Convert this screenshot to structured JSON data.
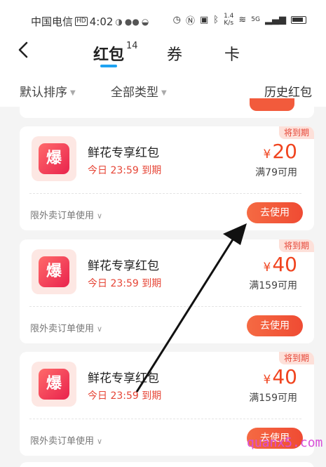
{
  "status_bar": {
    "carrier": "中国电信",
    "hd": "HD",
    "time": "4:02",
    "net_speed_value": "1.4",
    "net_speed_unit": "K/s",
    "network": "5G"
  },
  "header": {
    "tabs": [
      {
        "label": "红包",
        "count": "14"
      },
      {
        "label": "券"
      },
      {
        "label": "卡"
      }
    ],
    "active_tab_color": "#1ea3f2"
  },
  "filters": {
    "sort": "默认排序",
    "type": "全部类型",
    "history": "历史红包"
  },
  "coupons": [
    {
      "logo": "爆",
      "title": "鲜花专享红包",
      "expire": "今日 23:59 到期",
      "badge": "将到期",
      "currency": "¥",
      "amount": "20",
      "condition": "满79可用",
      "limit": "限外卖订单使用",
      "action": "去使用"
    },
    {
      "logo": "爆",
      "title": "鲜花专享红包",
      "expire": "今日 23:59 到期",
      "badge": "将到期",
      "currency": "¥",
      "amount": "40",
      "condition": "满159可用",
      "limit": "限外卖订单使用",
      "action": "去使用"
    },
    {
      "logo": "爆",
      "title": "鲜花专享红包",
      "expire": "今日 23:59 到期",
      "badge": "将到期",
      "currency": "¥",
      "amount": "40",
      "condition": "满159可用",
      "limit": "限外卖订单使用",
      "action": "去使用"
    }
  ],
  "watermark": "quanx5.com",
  "colors": {
    "accent": "#f0441f",
    "button": "#ef4b33",
    "background": "#f4f4f4"
  }
}
